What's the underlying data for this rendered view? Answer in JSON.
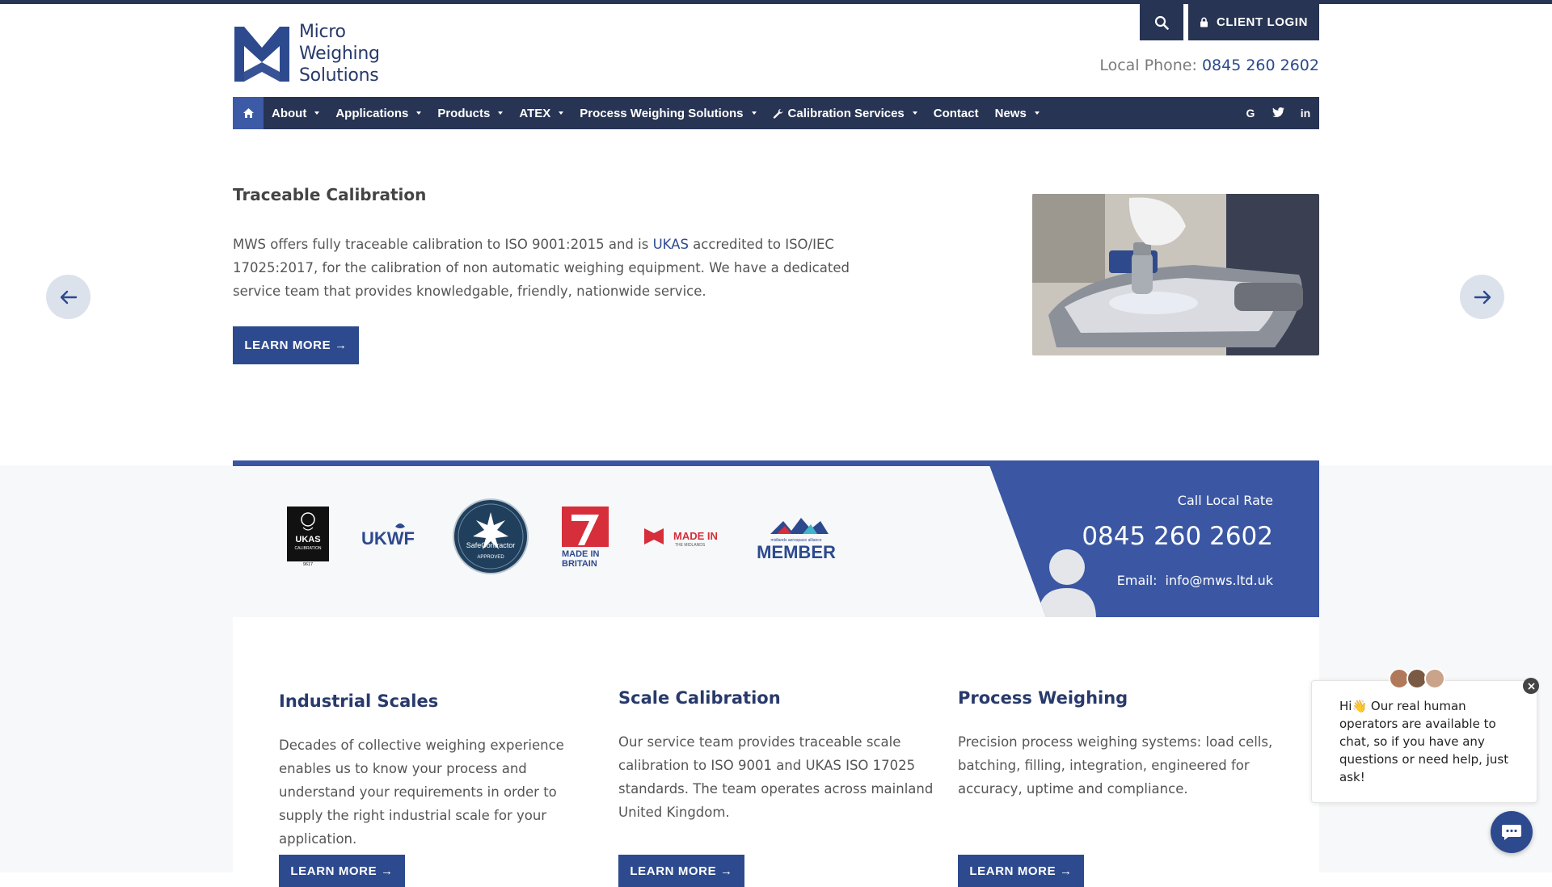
{
  "header": {
    "logo_lines": [
      "Micro",
      "Weighing",
      "Solutions"
    ],
    "client_login": "CLIENT LOGIN",
    "phone_label": "Local Phone:",
    "phone_number": "0845 260 2602"
  },
  "nav": {
    "items": [
      {
        "label": "About",
        "dropdown": true
      },
      {
        "label": "Applications",
        "dropdown": true
      },
      {
        "label": "Products",
        "dropdown": true
      },
      {
        "label": "ATEX",
        "dropdown": true
      },
      {
        "label": "Process Weighing Solutions",
        "dropdown": true
      },
      {
        "label": "Calibration Services",
        "dropdown": true
      },
      {
        "label": "Contact",
        "dropdown": false
      },
      {
        "label": "News",
        "dropdown": true
      }
    ],
    "social": [
      "G",
      "twitter-icon",
      "in"
    ]
  },
  "slide": {
    "title": "Traceable Calibration",
    "text_before": "MWS offers fully traceable calibration to ISO 9001:2015 and is ",
    "text_link": "UKAS",
    "text_after": " accredited to ISO/IEC 17025:2017, for the calibration of non automatic weighing equipment. We have a dedicated service team that provides knowledgable, friendly, nationwide service.",
    "button": "LEARN MORE →"
  },
  "certifications": {
    "logos": [
      {
        "name": "ukas-calibration-logo",
        "text": "UKAS",
        "sub": "CALIBRATION",
        "code": "9617"
      },
      {
        "name": "ukwf-logo",
        "text": "UKWF"
      },
      {
        "name": "safecontractor-logo",
        "text": "SafeContractor",
        "sub": "APPROVED"
      },
      {
        "name": "made-in-britain-logo",
        "text": "MADE IN",
        "sub": "BRITAIN"
      },
      {
        "name": "made-in-the-midlands-logo",
        "text": "MADE IN",
        "sub": "THE MIDLANDS"
      },
      {
        "name": "midlands-aerospace-alliance-logo",
        "text": "MEMBER",
        "sub": "midlands aerospace alliance"
      }
    ]
  },
  "contact": {
    "label": "Call Local Rate",
    "phone": "0845 260 2602",
    "email_label": "Email:",
    "email": "info@mws.ltd.uk"
  },
  "cards": [
    {
      "title": "Industrial Scales",
      "text": "Decades of collective weighing experience enables us to know your process and understand your requirements in order to supply the right industrial scale for your application.",
      "button": "LEARN MORE →"
    },
    {
      "title": "Scale Calibration",
      "text": "Our service team provides traceable scale calibration to ISO 9001 and UKAS ISO 17025 standards. The team operates across mainland United Kingdom.",
      "button": "LEARN MORE →"
    },
    {
      "title": "Process Weighing",
      "text": "Precision process weighing systems: load cells, batching, filling, integration, engineered for accuracy, uptime and compliance.",
      "button": "LEARN MORE →"
    }
  ],
  "chat": {
    "message": "Hi👋 Our real human operators are available to chat, so if you have any questions or need help, just ask!"
  },
  "colors": {
    "navy": "#283453",
    "brand_blue": "#2d4a8f",
    "panel_blue": "#3b57a3",
    "band_grey": "#f7f8f9"
  }
}
